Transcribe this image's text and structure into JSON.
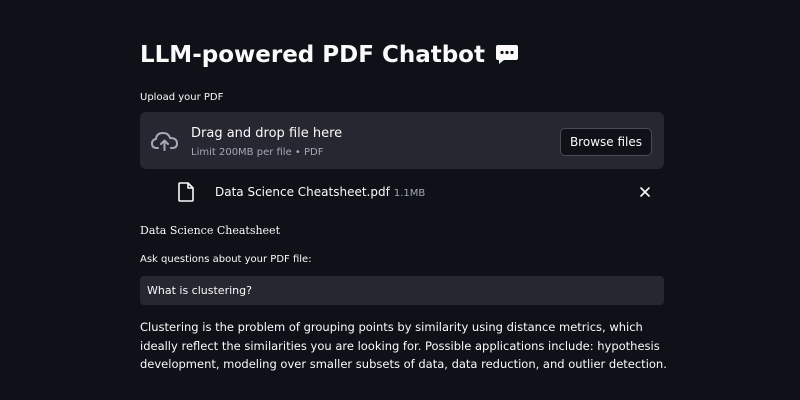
{
  "header": {
    "title": "LLM-powered PDF Chatbot",
    "title_icon": "speech-bubble-icon"
  },
  "uploader": {
    "label": "Upload your PDF",
    "drop_text": "Drag and drop file here",
    "limit_text": "Limit 200MB per file • PDF",
    "browse_label": "Browse files",
    "icon": "cloud-upload-icon"
  },
  "uploaded_file": {
    "name": "Data Science Cheatsheet.pdf",
    "size": "1.1MB",
    "icon": "file-icon",
    "remove_icon": "close-icon"
  },
  "document": {
    "title": "Data Science Cheatsheet"
  },
  "question": {
    "label": "Ask questions about your PDF file:",
    "value": "What is clustering?"
  },
  "answer": {
    "text": "Clustering is the problem of grouping points by similarity using distance metrics, which ideally reflect the similarities you are looking for. Possible applications include: hypothesis development, modeling over smaller subsets of data, data reduction, and outlier detection."
  },
  "colors": {
    "background": "#0e1117",
    "panel": "#262730",
    "text": "#fafafa",
    "muted": "#a3a8b8"
  }
}
